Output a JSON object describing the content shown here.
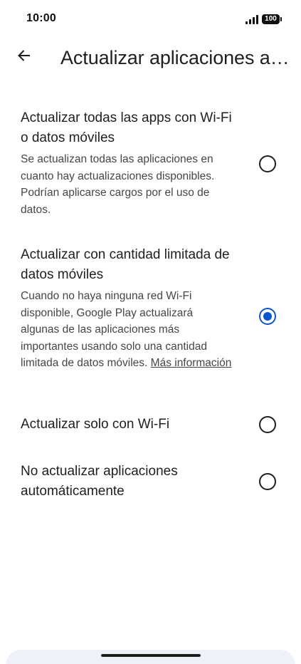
{
  "status_bar": {
    "time": "10:00",
    "battery": "100"
  },
  "header": {
    "title": "Actualizar aplicaciones automáticamente"
  },
  "options": [
    {
      "title": "Actualizar todas las apps con Wi-Fi o datos móviles",
      "description": "Se actualizan todas las aplicaciones en cuanto hay actualizaciones disponibles. Podrían aplicarse cargos por el uso de datos.",
      "selected": false
    },
    {
      "title": "Actualizar con cantidad limitada de datos móviles",
      "description": "Cuando no haya ninguna red Wi-Fi disponible, Google Play actualizará algunas de las aplicaciones más importantes usando solo una cantidad limitada de datos móviles.",
      "link": "Más información",
      "selected": true
    },
    {
      "title": "Actualizar solo con Wi-Fi",
      "selected": false
    },
    {
      "title": "No actualizar aplicaciones automáticamente",
      "selected": false
    }
  ],
  "colors": {
    "accent": "#0b57d0",
    "text": "#1f1f1f",
    "secondary_text": "#444746"
  },
  "icons": {
    "back": "arrow-back-icon",
    "signal": "signal-icon",
    "battery": "battery-icon"
  }
}
